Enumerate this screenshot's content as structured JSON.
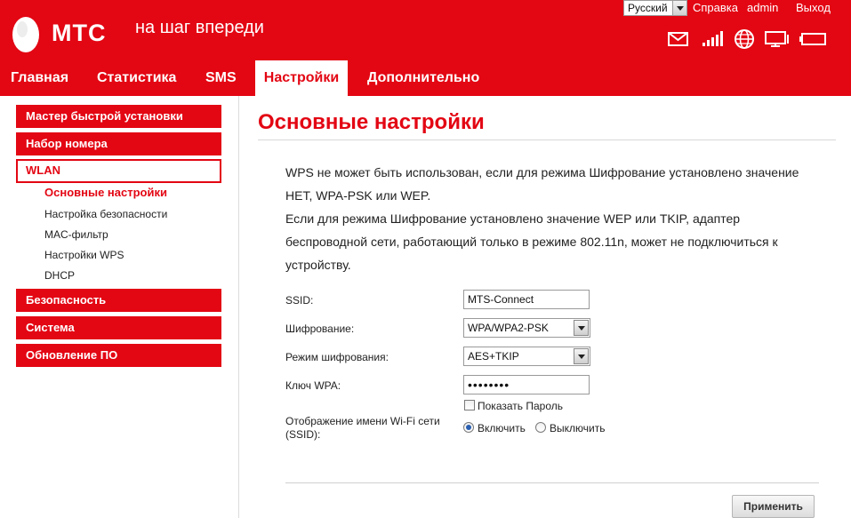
{
  "header": {
    "brand": "МТС",
    "slogan": "на шаг впереди",
    "language": "Русский",
    "links": {
      "help": "Справка",
      "user": "admin",
      "logout": "Выход"
    },
    "status_icons": [
      "envelope-icon",
      "signal-strength-icon",
      "globe-icon",
      "computer-icon",
      "battery-icon"
    ]
  },
  "tabs": [
    "Главная",
    "Статистика",
    "SMS",
    "Настройки",
    "Дополнительно"
  ],
  "active_tab": "Настройки",
  "sidebar": {
    "sections": [
      "Мастер быстрой установки",
      "Набор номера",
      "WLAN",
      "Безопасность",
      "Система",
      "Обновление ПО"
    ],
    "wlan_items": [
      "Основные настройки",
      "Настройка безопасности",
      "MAC-фильтр",
      "Настройки WPS",
      "DHCP"
    ],
    "active_item": "Основные настройки"
  },
  "main": {
    "title": "Основные настройки",
    "note_lines": [
      "WPS не может быть использован, если для режима Шифрование установлено значение",
      "НЕТ, WPA-PSK или WEP.",
      "Если для режима Шифрование установлено значение WEP или TKIP, адаптер",
      "беспроводной сети, работающий только в режиме 802.11n, может не подключиться к",
      "устройству."
    ],
    "form": {
      "ssid_label": "SSID:",
      "ssid_value": "MTS-Connect",
      "encryption_label": "Шифрование:",
      "encryption_value": "WPA/WPA2-PSK",
      "encryption_mode_label": "Режим шифрования:",
      "encryption_mode_value": "AES+TKIP",
      "wpa_key_label": "Ключ WPA:",
      "wpa_key_value": "••••••••",
      "show_password_label": "Показать Пароль",
      "show_password_checked": false,
      "ssid_broadcast_label_line1": "Отображение имени Wi-Fi сети",
      "ssid_broadcast_label_line2": "(SSID):",
      "broadcast_on_label": "Включить",
      "broadcast_off_label": "Выключить",
      "broadcast_selected": "Включить"
    },
    "apply_label": "Применить"
  },
  "colors": {
    "accent": "#e30613",
    "radio_dot": "#2a5fb0"
  }
}
